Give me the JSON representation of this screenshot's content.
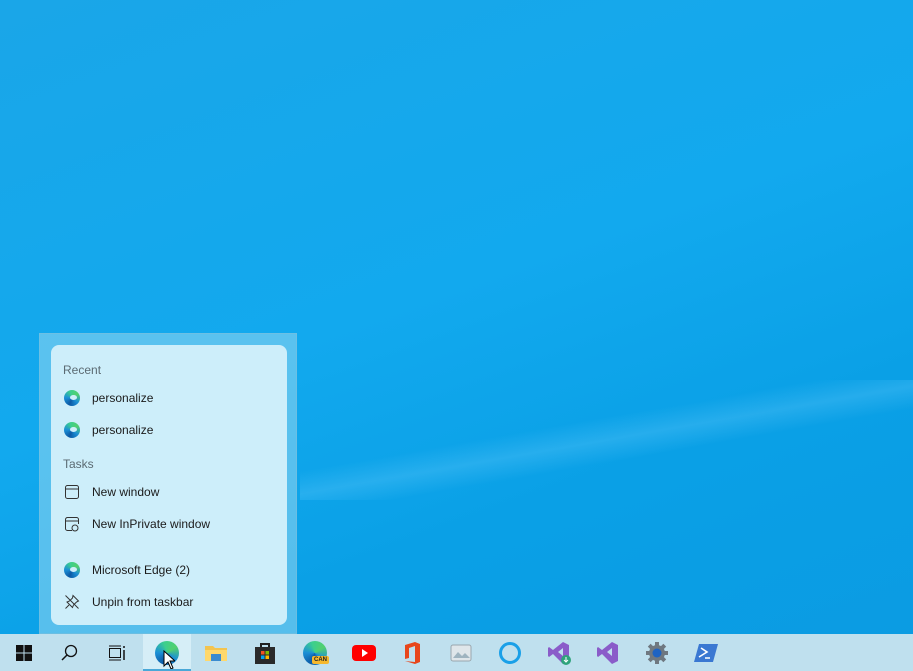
{
  "jump_list": {
    "recent_header": "Recent",
    "recent": [
      {
        "label": "personalize",
        "icon": "edge-icon"
      },
      {
        "label": "personalize",
        "icon": "edge-icon"
      }
    ],
    "tasks_header": "Tasks",
    "tasks": [
      {
        "label": "New window",
        "icon": "window-icon"
      },
      {
        "label": "New InPrivate window",
        "icon": "inprivate-icon"
      }
    ],
    "app": {
      "label": "Microsoft Edge (2)",
      "icon": "edge-icon"
    },
    "unpin": {
      "label": "Unpin from taskbar",
      "icon": "unpin-icon"
    }
  },
  "taskbar": {
    "items": [
      "start",
      "search",
      "task-view",
      "microsoft-edge",
      "file-explorer",
      "microsoft-store",
      "edge-canary",
      "youtube",
      "office",
      "photos-app",
      "cortana",
      "visual-studio-installer",
      "visual-studio",
      "settings",
      "powershell"
    ],
    "canary_badge": "CAN"
  }
}
